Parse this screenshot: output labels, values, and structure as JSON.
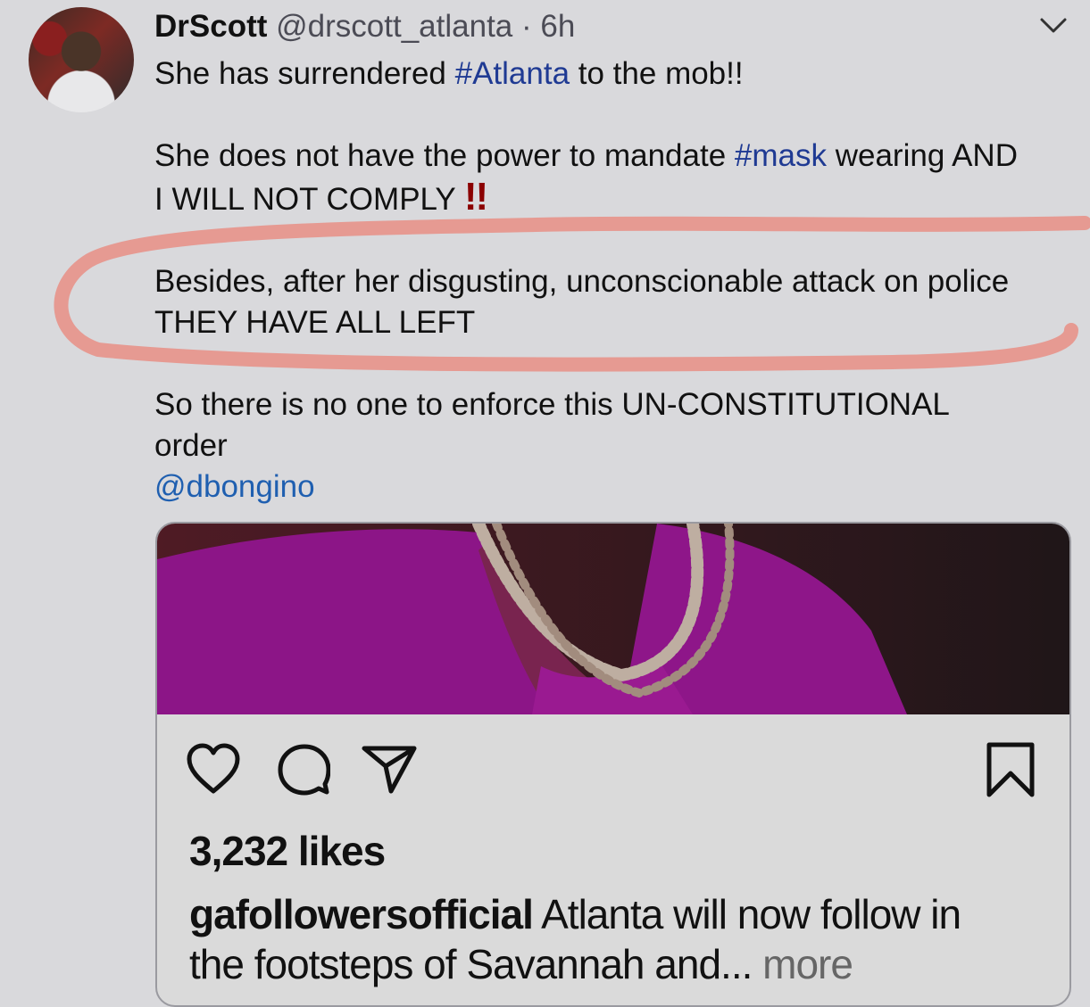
{
  "tweet": {
    "author_name": "DrScott",
    "author_handle": "@drscott_atlanta",
    "separator": "·",
    "time_ago": "6h",
    "line1_pre": "She has surrendered ",
    "line1_tag": "#Atlanta",
    "line1_post": " to the mob!!",
    "line2_pre": "She does not have the power to mandate ",
    "line2_tag": "#mask",
    "line2_post": " wearing AND",
    "line3": "I WILL NOT COMPLY ",
    "line3_emoji": "!!",
    "line4": "Besides, after her disgusting, unconscionable attack on police",
    "line5": "THEY HAVE ALL LEFT",
    "line6": "So there is no one to enforce this UN-CONSTITUTIONAL",
    "line7": "order",
    "mention": "@dbongino",
    "highlight_color": "#e98a80",
    "hashtag_color": "#1f3a93"
  },
  "embed": {
    "likes": "3,232 likes",
    "caption_user": "gafollowersofficial",
    "caption_text1": " Atlanta will now follow in",
    "caption_text2": "the footsteps of Savannah and... ",
    "caption_more": "more",
    "icons": [
      "heart-icon",
      "comment-icon",
      "share-icon",
      "bookmark-icon"
    ]
  }
}
